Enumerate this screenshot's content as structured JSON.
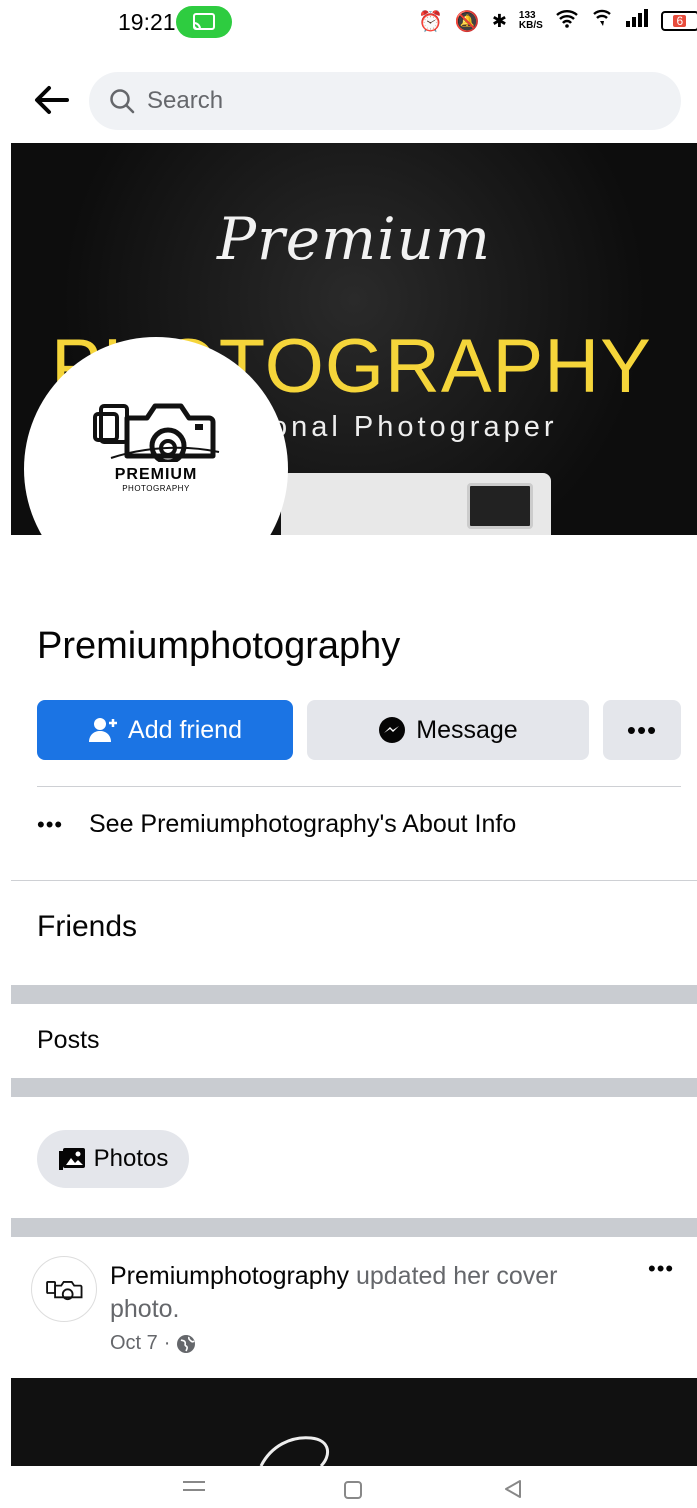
{
  "status_bar": {
    "time": "19:21",
    "data_speed": "133",
    "data_unit": "KB/S",
    "battery": "6",
    "accent_color": "#2ecc40"
  },
  "search": {
    "placeholder": "Search"
  },
  "cover": {
    "script_text": "Premium",
    "title_text": "PHOTOGRAPHY",
    "subtitle_text": "onal Photograper"
  },
  "avatar": {
    "brand": "PREMIUM",
    "brand_sub": "PHOTOGRAPHY"
  },
  "profile": {
    "name": "Premiumphotography"
  },
  "actions": {
    "add_friend": "Add friend",
    "message": "Message",
    "more": "•••",
    "primary_color": "#1b74e4"
  },
  "about": {
    "dots": "•••",
    "label": "See Premiumphotography's About Info"
  },
  "sections": {
    "friends": "Friends",
    "posts": "Posts",
    "photos": "Photos"
  },
  "post": {
    "author": "Premiumphotography",
    "action": " updated her cover photo.",
    "date": "Oct 7",
    "separator": "·",
    "more": "•••"
  }
}
